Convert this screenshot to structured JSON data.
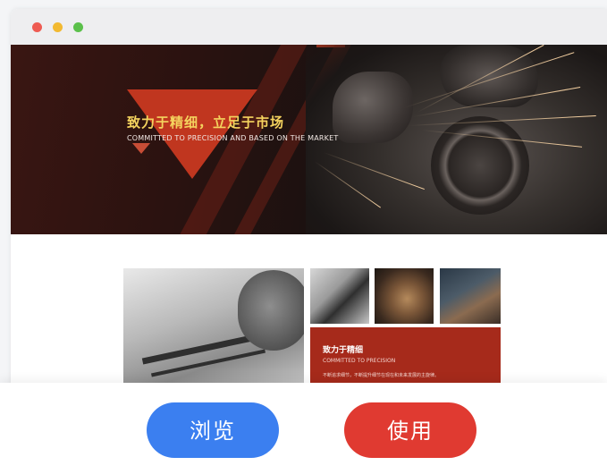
{
  "window": {
    "controls": [
      "close",
      "minimize",
      "maximize"
    ]
  },
  "hero": {
    "title_cn": "致力于精细，立足于市场",
    "title_en": "COMMITTED TO PRECISION AND BASED ON THE MARKET"
  },
  "card": {
    "title_cn": "致力于精细",
    "subtitle_en": "COMMITTED TO PRECISION",
    "description": "不断追求细节，不断提升细节在现在和未来发展的主旋律。"
  },
  "actions": {
    "browse_label": "浏览",
    "use_label": "使用"
  },
  "colors": {
    "accent_red": "#c0361f",
    "title_yellow": "#f4d35e",
    "browse_blue": "#3b7ff0",
    "use_red": "#e03a31"
  }
}
